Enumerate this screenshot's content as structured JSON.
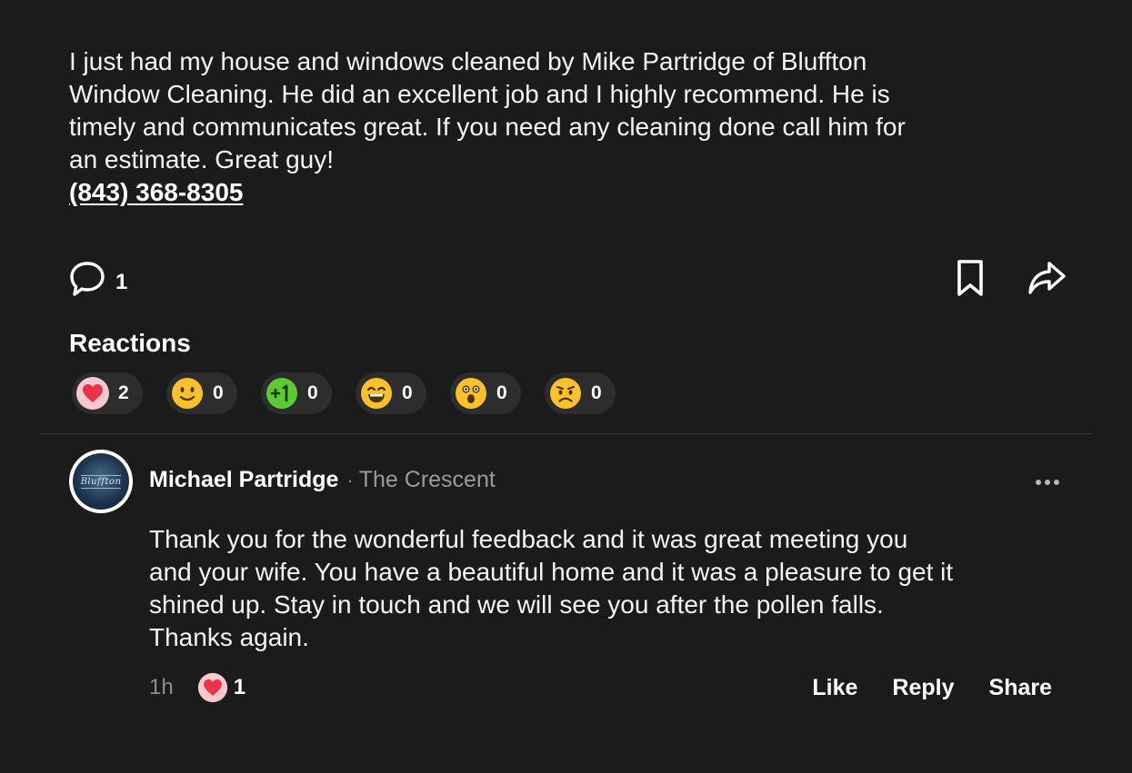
{
  "post": {
    "body_lines": [
      "I just had my house and windows cleaned by Mike Partridge of Bluffton",
      "Window Cleaning. He did an excellent job and I highly recommend. He is",
      "timely and communicates great. If you need any cleaning done call him for",
      "an estimate. Great guy!"
    ],
    "phone": "(843) 368-8305",
    "comment_count": "1",
    "icons": {
      "comment": "speech-bubble-icon",
      "bookmark": "bookmark-icon",
      "share": "share-arrow-icon"
    }
  },
  "reactions": {
    "title": "Reactions",
    "items": [
      {
        "icon": "heart",
        "count": "2"
      },
      {
        "icon": "smiling-face",
        "count": "0"
      },
      {
        "icon": "plus-one",
        "count": "0"
      },
      {
        "icon": "laughing-face",
        "count": "0"
      },
      {
        "icon": "surprised-face",
        "count": "0"
      },
      {
        "icon": "sad-face",
        "count": "0"
      }
    ]
  },
  "comment": {
    "avatar_text": "Bluffton",
    "author": "Michael Partridge",
    "separator": "·",
    "neighborhood": "The Crescent",
    "body_lines": [
      "Thank you for the wonderful feedback and it was great meeting you",
      "and your wife. You have a beautiful home and it was a pleasure to get it",
      "shined up. Stay in touch and we will see you after the pollen falls.",
      "Thanks again."
    ],
    "timestamp": "1h",
    "heart_count": "1",
    "actions": {
      "like": "Like",
      "reply": "Reply",
      "share": "Share"
    }
  },
  "colors": {
    "background": "#1b1b1b",
    "chip": "#2d2d2d",
    "muted_text": "#9a9a9a",
    "heart": "#e8334a"
  }
}
